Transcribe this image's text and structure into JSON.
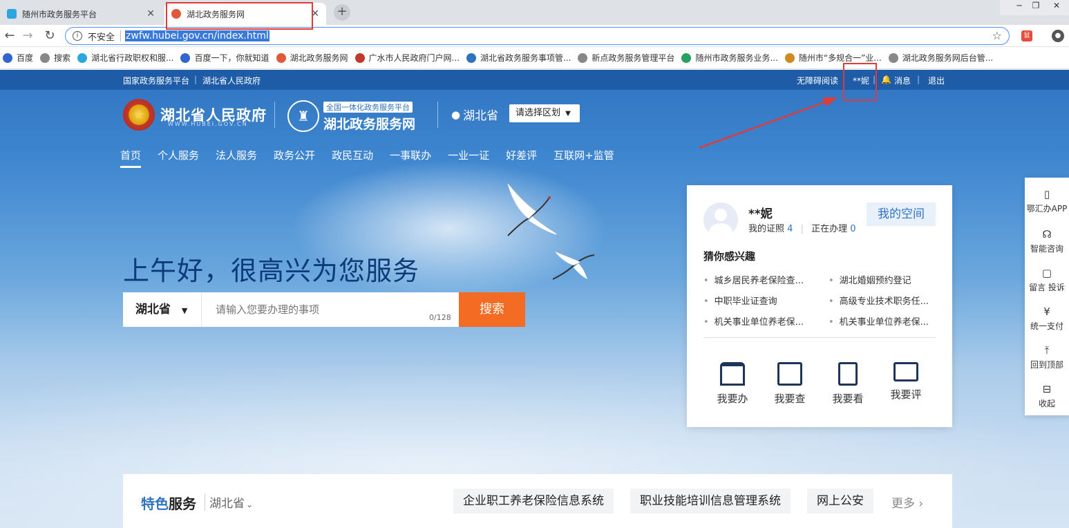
{
  "browser": {
    "tabs": [
      {
        "title": "随州市政务服务平台",
        "active": false,
        "favicon_color": "#2aa7e0"
      },
      {
        "title": "湖北政务服务网",
        "active": true,
        "favicon_color": "#e05a3a"
      }
    ],
    "new_tab_symbol": "+",
    "address": {
      "security_label": "不安全",
      "url": "zwfw.hubei.gov.cn/index.html"
    },
    "extension_label": "鼠",
    "bookmarks": [
      {
        "label": "百度",
        "color": "#3366cc",
        "icon": "baidu-paw-icon"
      },
      {
        "label": "搜索",
        "color": "#888888",
        "icon": "page-icon"
      },
      {
        "label": "湖北省行政职权和服...",
        "color": "#2aa7e0",
        "icon": "cloud-icon"
      },
      {
        "label": "百度一下，你就知道",
        "color": "#3366cc",
        "icon": "baidu-paw-icon"
      },
      {
        "label": "湖北政务服务网",
        "color": "#e05a3a",
        "icon": "site-logo-icon"
      },
      {
        "label": "广水市人民政府门户网...",
        "color": "#c0392b",
        "icon": "emblem-icon"
      },
      {
        "label": "湖北省政务服务事项管...",
        "color": "#2f73c0",
        "icon": "globe-icon"
      },
      {
        "label": "新点政务服务管理平台",
        "color": "#888888",
        "icon": "page-icon"
      },
      {
        "label": "随州市政务服务业务...",
        "color": "#27a060",
        "icon": "circle-icon"
      },
      {
        "label": "随州市“多规合一”业...",
        "color": "#d08a20",
        "icon": "figure-icon"
      },
      {
        "label": "湖北政务服务网后台管...",
        "color": "#888888",
        "icon": "page-icon"
      }
    ]
  },
  "site": {
    "top_links": {
      "left1": "国家政务服务平台",
      "left2": "湖北省人民政府",
      "accessibility": "无障碍阅读",
      "user": "**妮",
      "messages": "消息",
      "logout": "退出"
    },
    "header": {
      "gov_name": "湖北省人民政府",
      "gov_domain": "WWW.HUBEI.GOV.CN",
      "platform_tag": "全国一体化政务服务平台",
      "platform_name": "湖北政务服务网",
      "region": "湖北省",
      "region_select": "请选择区划"
    },
    "nav": [
      "首页",
      "个人服务",
      "法人服务",
      "政务公开",
      "政民互动",
      "一事联办",
      "一业一证",
      "好差评",
      "互联网+监管"
    ],
    "greeting": "上午好，很高兴为您服务",
    "search": {
      "region": "湖北省",
      "placeholder": "请输入您要办理的事项",
      "count": "0/128",
      "button": "搜索"
    },
    "user_panel": {
      "name": "**妮",
      "certs_label": "我的证照",
      "certs_count": "4",
      "processing_label": "正在办理",
      "processing_count": "0",
      "my_space": "我的空间",
      "interest_title": "猜你感兴趣",
      "interests": [
        "城乡居民养老保险查...",
        "湖北婚姻预约登记",
        "中职毕业证查询",
        "高级专业技术职务任...",
        "机关事业单位养老保...",
        "机关事业单位养老保..."
      ],
      "actions": [
        "我要办",
        "我要查",
        "我要看",
        "我要评"
      ]
    },
    "sidebar": [
      "鄂汇办APP",
      "智能咨询",
      "留言 投诉",
      "统一支付",
      "回到顶部",
      "收起"
    ],
    "features": {
      "title_a": "特色",
      "title_b": "服务",
      "region": "湖北省",
      "items": [
        "企业职工养老保险信息系统",
        "职业技能培训信息管理系统",
        "网上公安"
      ],
      "more": "更多"
    }
  },
  "annotation_color": "#e03a3a"
}
